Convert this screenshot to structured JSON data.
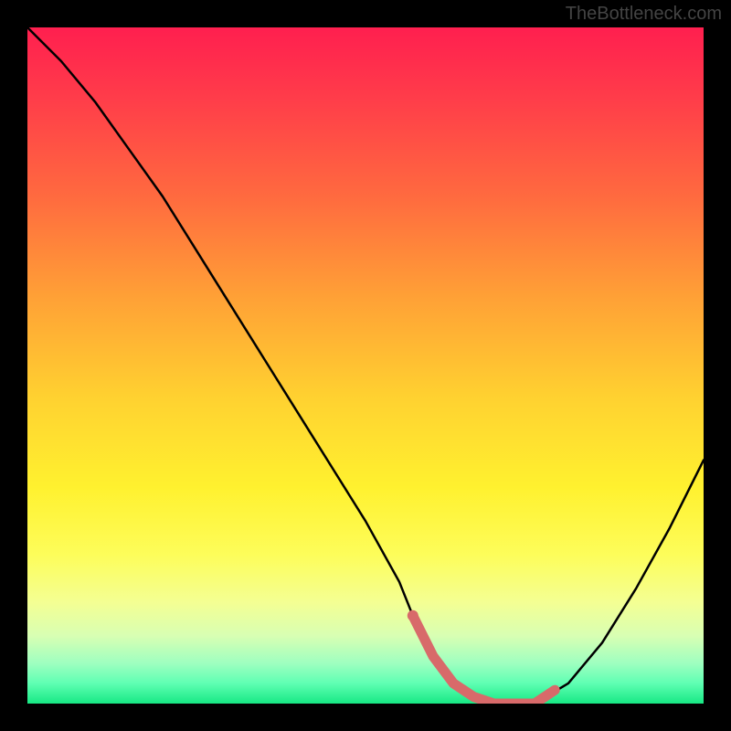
{
  "watermark": "TheBottleneck.com",
  "chart_data": {
    "type": "line",
    "title": "",
    "xlabel": "",
    "ylabel": "",
    "xlim": [
      0,
      100
    ],
    "ylim": [
      0,
      100
    ],
    "grid": false,
    "legend": false,
    "series": [
      {
        "name": "curve",
        "color": "#000000",
        "x": [
          0,
          5,
          10,
          15,
          20,
          25,
          30,
          35,
          40,
          45,
          50,
          55,
          57,
          60,
          63,
          66,
          69,
          72,
          75,
          80,
          85,
          90,
          95,
          100
        ],
        "y": [
          100,
          95,
          89,
          82,
          75,
          67,
          59,
          51,
          43,
          35,
          27,
          18,
          13,
          7,
          3,
          1,
          0,
          0,
          0,
          3,
          9,
          17,
          26,
          36
        ]
      },
      {
        "name": "highlight",
        "color": "#d86a6a",
        "x": [
          57,
          60,
          63,
          66,
          69,
          72,
          75,
          78
        ],
        "y": [
          13,
          7,
          3,
          1,
          0,
          0,
          0,
          2
        ]
      }
    ],
    "background_gradient": {
      "top": "#ff1f4f",
      "mid1": "#ffa136",
      "mid2": "#fff12f",
      "bottom": "#17e884"
    }
  }
}
